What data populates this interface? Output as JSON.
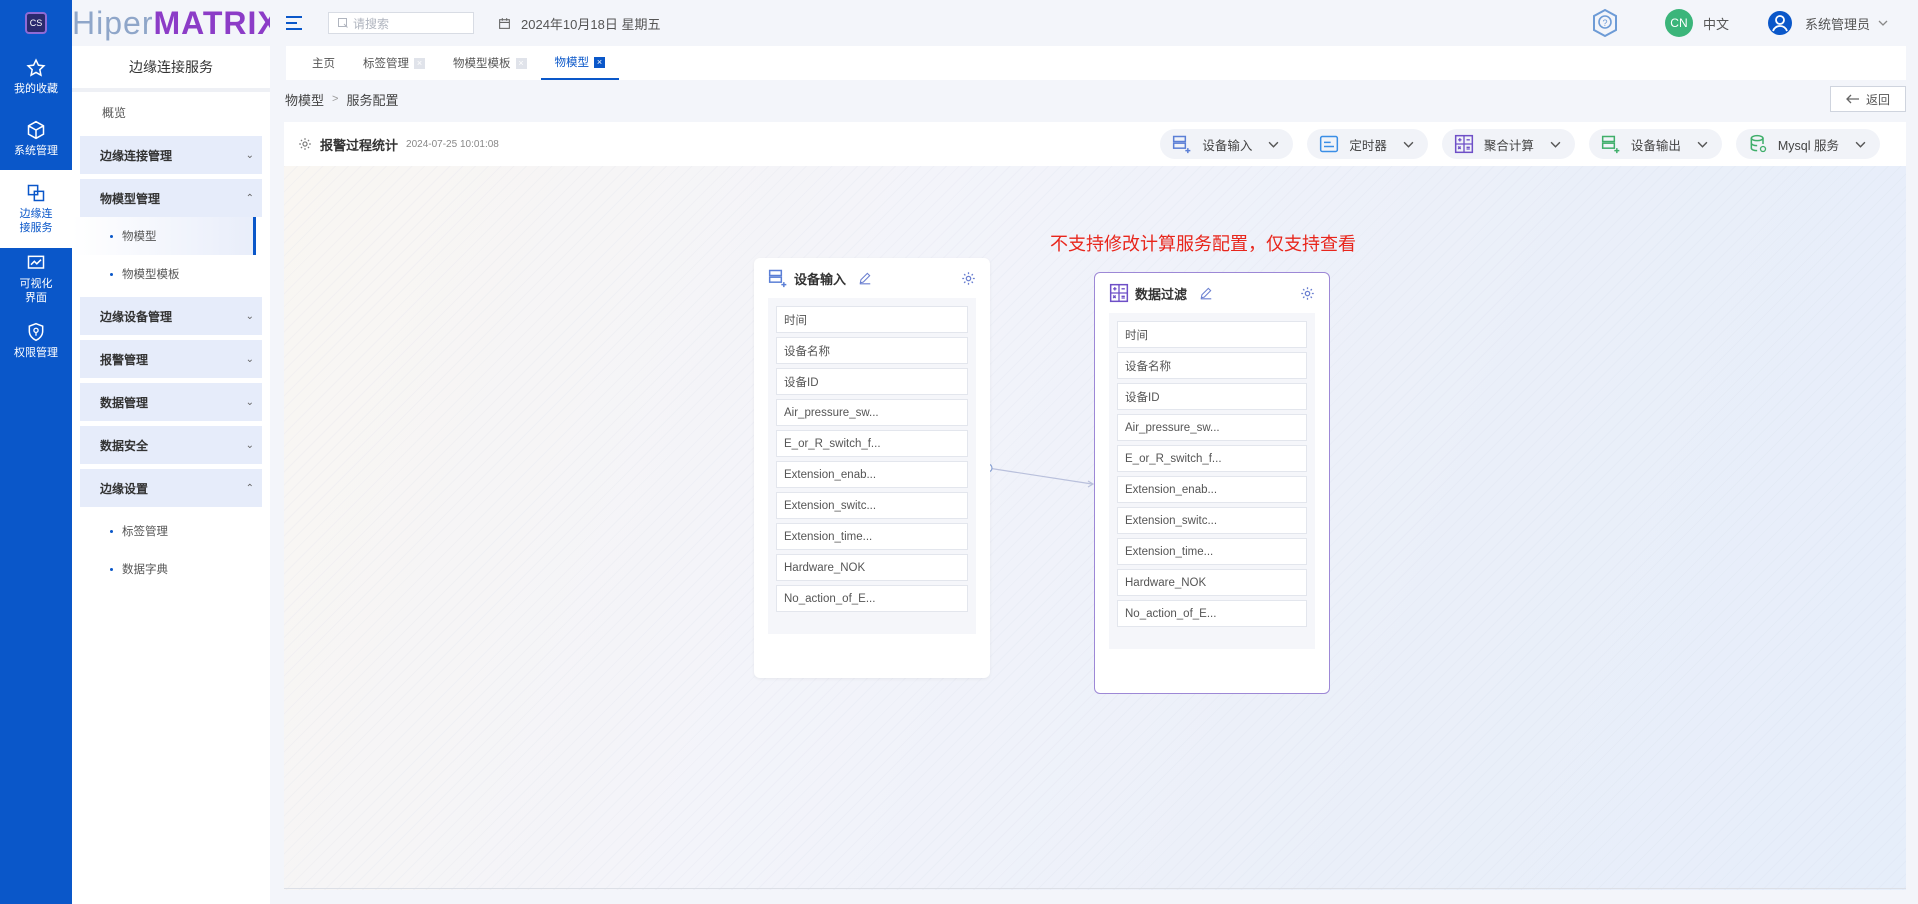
{
  "brand": {
    "part1": "Hiper",
    "part2": "MATRIX"
  },
  "rail": [
    {
      "label": "我的收藏",
      "icon": "star-icon"
    },
    {
      "label": "系统管理",
      "icon": "cube-icon"
    },
    {
      "label": "边缘连接服务",
      "icon": "link-squares-icon"
    },
    {
      "label": "可视化界面",
      "icon": "dashboard-icon"
    },
    {
      "label": "权限管理",
      "icon": "shield-icon"
    }
  ],
  "header": {
    "search_placeholder": "请搜索",
    "date": "2024年10月18日 星期五",
    "lang_badge": "CN",
    "lang_label": "中文",
    "user_name": "系统管理员"
  },
  "sidebar": {
    "title": "边缘连接服务",
    "overview": "概览",
    "groups": [
      {
        "label": "边缘连接管理"
      },
      {
        "label": "物模型管理",
        "subs": [
          "物模型",
          "物模型模板"
        ]
      },
      {
        "label": "边缘设备管理"
      },
      {
        "label": "报警管理"
      },
      {
        "label": "数据管理"
      },
      {
        "label": "数据安全"
      },
      {
        "label": "边缘设置",
        "subs": [
          "标签管理",
          "数据字典"
        ]
      }
    ]
  },
  "tabs": [
    "主页",
    "标签管理",
    "物模型模板",
    "物模型"
  ],
  "breadcrumb": {
    "parent": "物模型",
    "sep": ">",
    "current": "服务配置"
  },
  "back_label": "返回",
  "toolbar": {
    "title": "报警过程统计",
    "time": "2024-07-25 10:01:08",
    "actions": [
      "设备输入",
      "定时器",
      "聚合计算",
      "设备输出",
      "Mysql 服务"
    ]
  },
  "notice": "不支持修改计算服务配置，仅支持查看",
  "nodes": [
    {
      "title": "设备输入",
      "fields": [
        "时间",
        "设备名称",
        "设备ID",
        "Air_pressure_sw...",
        "E_or_R_switch_f...",
        "Extension_enab...",
        "Extension_switc...",
        "Extension_time...",
        "Hardware_NOK",
        "No_action_of_E..."
      ]
    },
    {
      "title": "数据过滤",
      "fields": [
        "时间",
        "设备名称",
        "设备ID",
        "Air_pressure_sw...",
        "E_or_R_switch_f...",
        "Extension_enab...",
        "Extension_switc...",
        "Extension_time...",
        "Hardware_NOK",
        "No_action_of_E..."
      ]
    }
  ],
  "colors": {
    "primary": "#0a57c9",
    "notice": "#e8261c",
    "node_border": "#9d88d6"
  }
}
